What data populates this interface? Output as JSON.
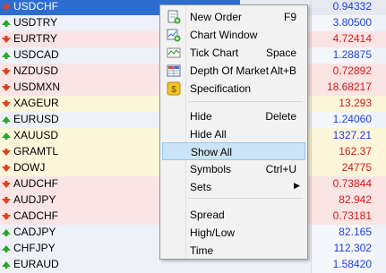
{
  "colors": {
    "up": "#1c3fe0",
    "down": "#d11a1a",
    "selected": "#2d6dcf"
  },
  "market_watch": {
    "rows": [
      {
        "symbol": "USDCHF",
        "price": "0.94332",
        "dir": "down",
        "selected": true
      },
      {
        "symbol": "USDTRY",
        "price": "3.80500",
        "dir": "up"
      },
      {
        "symbol": "EURTRY",
        "price": "4.72414",
        "dir": "down"
      },
      {
        "symbol": "USDCAD",
        "price": "1.28875",
        "dir": "up"
      },
      {
        "symbol": "NZDUSD",
        "price": "0.72892",
        "dir": "down"
      },
      {
        "symbol": "USDMXN",
        "price": "18.68217",
        "dir": "down"
      },
      {
        "symbol": "XAGEUR",
        "price": "13.293",
        "dir": "down",
        "amber": true
      },
      {
        "symbol": "EURUSD",
        "price": "1.24060",
        "dir": "up"
      },
      {
        "symbol": "XAUUSD",
        "price": "1327.21",
        "dir": "up",
        "amber": true
      },
      {
        "symbol": "GRAMTL",
        "price": "162.37",
        "dir": "down",
        "amber": true
      },
      {
        "symbol": "DOWJ",
        "price": "24775",
        "dir": "down",
        "amber": true
      },
      {
        "symbol": "AUDCHF",
        "price": "0.73844",
        "dir": "down"
      },
      {
        "symbol": "AUDJPY",
        "price": "82.942",
        "dir": "down"
      },
      {
        "symbol": "CADCHF",
        "price": "0.73181",
        "dir": "down"
      },
      {
        "symbol": "CADJPY",
        "price": "82.165",
        "dir": "up"
      },
      {
        "symbol": "CHFJPY",
        "price": "112.302",
        "dir": "up"
      },
      {
        "symbol": "EURAUD",
        "price": "1.58420",
        "dir": "up"
      }
    ]
  },
  "context_menu": {
    "items": [
      {
        "label": "New Order",
        "shortcut": "F9",
        "icon": "new-order-icon"
      },
      {
        "label": "Chart Window",
        "shortcut": "",
        "icon": "chart-window-icon"
      },
      {
        "label": "Tick Chart",
        "shortcut": "Space",
        "icon": "tick-chart-icon"
      },
      {
        "label": "Depth Of Market",
        "shortcut": "Alt+B",
        "icon": "depth-of-market-icon"
      },
      {
        "label": "Specification",
        "shortcut": "",
        "icon": "specification-icon"
      },
      {
        "label": "Hide",
        "shortcut": "Delete"
      },
      {
        "label": "Hide All",
        "shortcut": ""
      },
      {
        "label": "Show All",
        "shortcut": "",
        "hover": true
      },
      {
        "label": "Symbols",
        "shortcut": "Ctrl+U"
      },
      {
        "label": "Sets",
        "shortcut": "",
        "submenu": true
      },
      {
        "label": "Spread",
        "shortcut": ""
      },
      {
        "label": "High/Low",
        "shortcut": ""
      },
      {
        "label": "Time",
        "shortcut": ""
      }
    ]
  }
}
